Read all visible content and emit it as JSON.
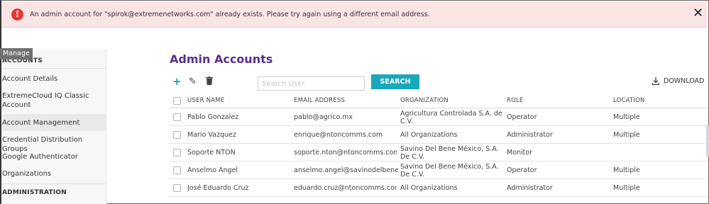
{
  "alert": {
    "message": "An admin account for \"spirok@extremenetworks.com\" already exists. Please try again using a different email address.",
    "icon": "exclamation-icon",
    "close_icon": "close-icon"
  },
  "sidebar": {
    "manage_tag": "Manage",
    "accounts_heading": "ACCOUNTS",
    "items": [
      {
        "label": "Account Details"
      },
      {
        "label": "ExtremeCloud IQ Classic Account"
      },
      {
        "label": "Account Management"
      },
      {
        "label": "Credential Distribution Groups"
      },
      {
        "label": "Google Authenticator"
      },
      {
        "label": "Organizations"
      }
    ],
    "administration_heading": "ADMINISTRATION"
  },
  "main": {
    "title": "Admin Accounts",
    "toolbar": {
      "add_icon": "add-icon",
      "edit_icon": "edit-icon",
      "delete_icon": "trash-icon",
      "search_placeholder": "Search User",
      "search_label": "SEARCH",
      "download_label": "DOWNLOAD"
    },
    "table": {
      "headers": {
        "user_name": "USER NAME",
        "email": "EMAIL ADDRESS",
        "organization": "ORGANIZATION",
        "role": "ROLE",
        "location": "LOCATION"
      },
      "rows": [
        {
          "name": "Pablo Gonzalez",
          "email": "pablo@agrico.mx",
          "org": "Agricultura Controlada S.A. de C.V.",
          "role": "Operator",
          "location": "Multiple"
        },
        {
          "name": "Mario Vazquez",
          "email": "enrique@ntoncomms.com",
          "org": "All Organizations",
          "role": "Administrator",
          "location": "Multiple"
        },
        {
          "name": "Soporte NTON",
          "email": "soporte.nton@ntoncomms.com",
          "org": "Savino Del Bene México, S.A. De C.V.",
          "role": "Monitor",
          "location": ""
        },
        {
          "name": "Anselmo Angel",
          "email": "anselmo.angel@savinodelbene.com",
          "org": "Savino Del Bene México, S.A. De C.V.",
          "role": "Operator",
          "location": "Multiple"
        },
        {
          "name": "José Eduardo Cruz",
          "email": "eduardo.cruz@ntoncomms.com",
          "org": "All Organizations",
          "role": "Administrator",
          "location": "Multiple"
        }
      ]
    }
  },
  "colors": {
    "alert_bg": "#fbe4e4",
    "alert_icon": "#e53935",
    "title": "#5b2e8f",
    "accent": "#1aa8bc"
  }
}
